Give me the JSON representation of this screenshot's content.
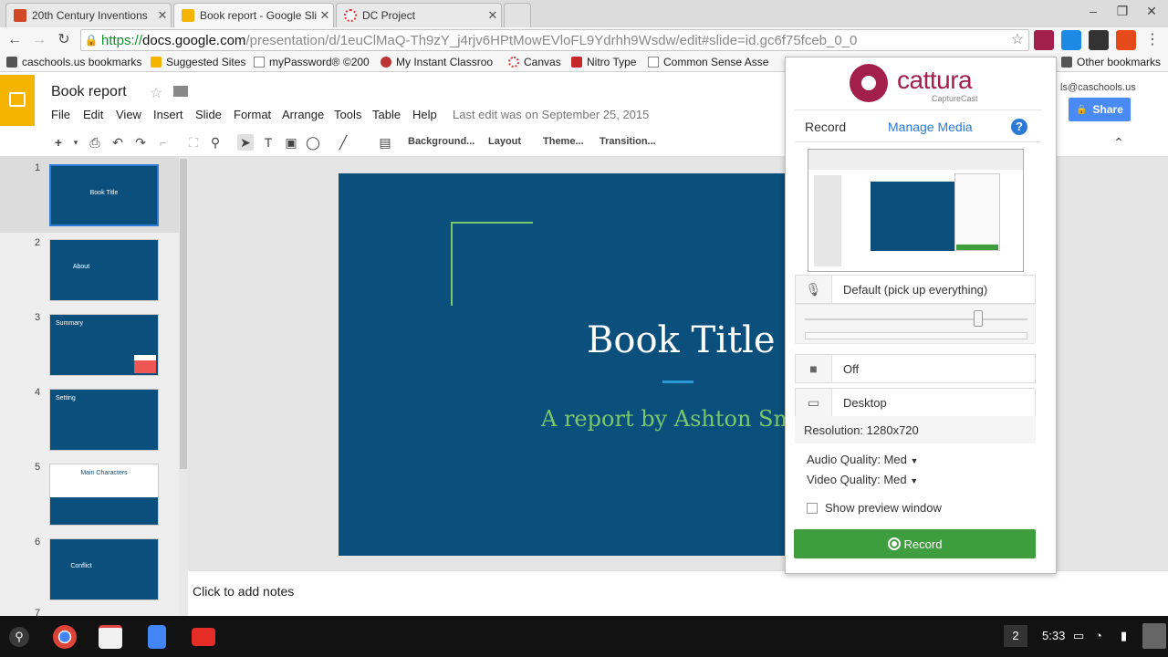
{
  "browser": {
    "tabs": [
      {
        "title": "20th Century Inventions",
        "favicon_color": "#d24726"
      },
      {
        "title": "Book report - Google Slide",
        "favicon_color": "#f4b400"
      },
      {
        "title": "DC Project",
        "favicon_color": "#d33"
      }
    ],
    "url": {
      "scheme": "https://",
      "host": "docs.google.com",
      "path": "/presentation/d/1euClMaQ-Th9zY_j4rjv6HPtMowEVloFL9Ydrhh9Wsdw/edit#slide=id.gc6f75fceb_0_0"
    },
    "bookmarks": [
      {
        "label": "caschools.us bookmarks",
        "icon": "folder-icon"
      },
      {
        "label": "Suggested Sites",
        "icon": "bookmark-icon"
      },
      {
        "label": "myPassword® ©200",
        "icon": "page-icon"
      },
      {
        "label": "My Instant Classroo",
        "icon": "classroom-icon"
      },
      {
        "label": "Canvas",
        "icon": "canvas-icon"
      },
      {
        "label": "Nitro Type",
        "icon": "nitro-icon"
      },
      {
        "label": "Common Sense Asse",
        "icon": "page-icon"
      },
      {
        "label": "Other bookmarks",
        "icon": "folder-icon"
      }
    ]
  },
  "slides": {
    "doc_title": "Book report",
    "menus": [
      "File",
      "Edit",
      "View",
      "Insert",
      "Slide",
      "Format",
      "Arrange",
      "Tools",
      "Table",
      "Help"
    ],
    "last_edit": "Last edit was on September 25, 2015",
    "toolbar": {
      "background": "Background...",
      "layout": "Layout",
      "theme": "Theme...",
      "transition": "Transition..."
    },
    "user_email": "ls@caschools.us",
    "share_label": "Share",
    "thumbnails": [
      {
        "num": "1",
        "label": "Book Title"
      },
      {
        "num": "2",
        "label": "About"
      },
      {
        "num": "3",
        "label": "Summary"
      },
      {
        "num": "4",
        "label": "Setting"
      },
      {
        "num": "5",
        "label": "Main Characters"
      },
      {
        "num": "6",
        "label": "Conflict"
      },
      {
        "num": "7",
        "label": ""
      }
    ],
    "slide": {
      "title": "Book Title",
      "subtitle": "A report by Ashton Sm"
    },
    "notes_placeholder": "Click to add notes"
  },
  "cattura": {
    "brand": "cattura",
    "subbrand": "CaptureCast",
    "tabs": {
      "record": "Record",
      "manage": "Manage Media"
    },
    "help": "?",
    "audio_source": "Default (pick up everything)",
    "video_source": "Off",
    "screen_source": "Desktop",
    "resolution": "Resolution: 1280x720",
    "audio_quality_label": "Audio Quality:",
    "audio_quality_value": "Med",
    "video_quality_label": "Video Quality:",
    "video_quality_value": "Med",
    "show_preview_label": "Show preview window",
    "record_label": "Record"
  },
  "shelf": {
    "badge": "2",
    "time": "5:33"
  }
}
